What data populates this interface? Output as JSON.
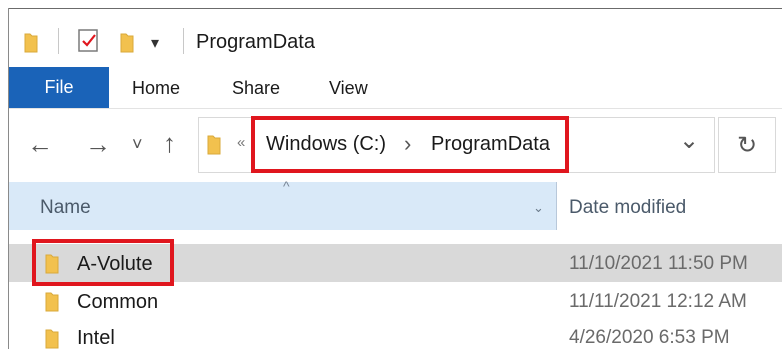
{
  "window": {
    "title": "ProgramData"
  },
  "quick_access": {
    "dropdown_glyph": "▾"
  },
  "ribbon": {
    "tabs": [
      {
        "label": "File"
      },
      {
        "label": "Home"
      },
      {
        "label": "Share"
      },
      {
        "label": "View"
      }
    ]
  },
  "nav": {
    "back_glyph": "←",
    "forward_glyph": "→",
    "recent_glyph": "˅",
    "up_glyph": "↑",
    "overflow_glyph": "«",
    "dropdown_glyph": "⌄",
    "refresh_glyph": "↻"
  },
  "address": {
    "segments": [
      "Windows (C:)",
      "ProgramData"
    ],
    "separator": "›"
  },
  "columns": {
    "name": "Name",
    "date_modified": "Date modified",
    "sort_glyph": "^",
    "chevron_glyph": "⌄"
  },
  "rows": [
    {
      "name": "A-Volute",
      "date": "11/10/2021 11:50 PM",
      "selected": true
    },
    {
      "name": "Common",
      "date": "11/11/2021 12:12 AM",
      "selected": false
    },
    {
      "name": "Intel",
      "date": "4/26/2020 6:53 PM",
      "selected": false
    }
  ],
  "colors": {
    "accent": "#1a63b8",
    "highlight": "#e0161e",
    "folder": "#f2c14e",
    "header_bg": "#d9e9f8",
    "selected_row": "#d9d9d9"
  },
  "icons": {
    "folder": "folder-icon",
    "properties": "properties-icon",
    "refresh": "refresh-icon"
  }
}
